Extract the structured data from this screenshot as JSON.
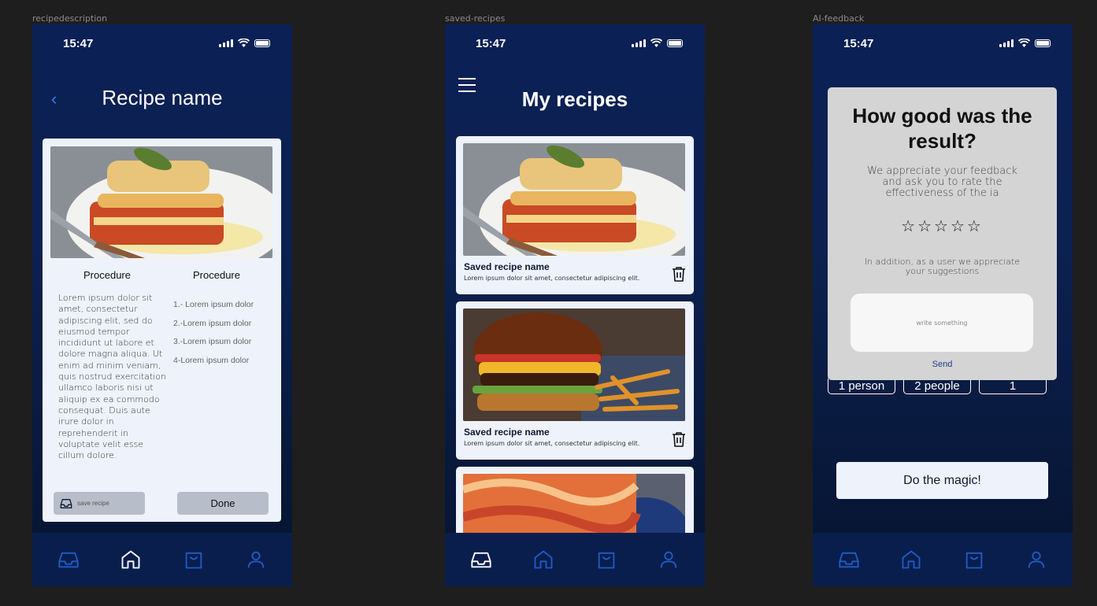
{
  "frames": [
    {
      "label": "recipedescription"
    },
    {
      "label": "saved-recipes"
    },
    {
      "label": "AI-feedback"
    }
  ],
  "status": {
    "time": "15:47"
  },
  "recipe": {
    "back_icon": "chevron-left-icon",
    "title": "Recipe name",
    "procedure_left": "Procedure",
    "procedure_right": "Procedure",
    "body": "Lorem ipsum dolor sit amet, consectetur adipiscing elit, sed do eiusmod tempor incididunt ut labore et dolore magna aliqua. Ut enim ad minim veniam, quis nostrud exercitation ullamco laboris nisi ut aliquip ex ea commodo consequat. Duis aute irure dolor in reprehenderit in voluptate velit esse cillum dolore.",
    "steps": [
      "1.- Lorem ipsum dolor",
      "2.-Lorem ipsum dolor",
      "3.-Lorem ipsum dolor",
      "4-Lorem ipsum dolor"
    ],
    "save_label": "save recipe",
    "done_label": "Done"
  },
  "saved": {
    "title": "My recipes",
    "items": [
      {
        "name": "Saved recipe name",
        "desc": "Lorem ipsum dolor sit amet, consectetur adipiscing elit."
      },
      {
        "name": "Saved recipe name",
        "desc": "Lorem ipsum dolor sit amet, consectetur adipiscing elit."
      }
    ]
  },
  "feedback": {
    "title": "How good was the result?",
    "subtitle": "We appreciate your feedback and ask you to rate the effectiveness of the ia",
    "stars": "☆☆☆☆☆",
    "suggestion": "In addition, as a user we appreciate your suggestions",
    "placeholder": "write something",
    "send_label": "Send",
    "chips": [
      "1 person",
      "2 people",
      "1"
    ],
    "magic_label": "Do the magic!"
  },
  "tabbar_icons": [
    "inbox-icon",
    "home-icon",
    "shopping-bag-icon",
    "user-icon"
  ],
  "colors": {
    "navy": "#0b2055",
    "tab_blue": "#1f5bc4",
    "card": "#eef2fb",
    "accent": "#3b7be0"
  }
}
